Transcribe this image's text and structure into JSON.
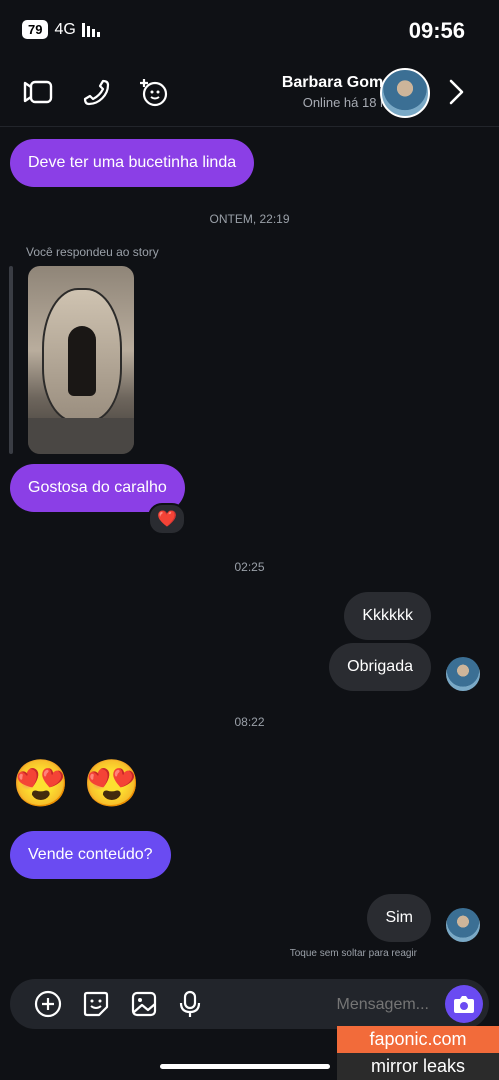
{
  "status_bar": {
    "time": "09:56",
    "network": "4G",
    "battery": "79"
  },
  "header": {
    "name": "Barbara Gomes",
    "status": "Online há 18 min"
  },
  "messages": {
    "m1": "Deve ter uma bucetinha linda",
    "divider1": "ONTEM, 22:19",
    "story_reply_label": "Você respondeu ao story",
    "m2": "Gostosa do caralho",
    "m2_reaction": "❤️",
    "divider2": "02:25",
    "m3": "Kkkkkk",
    "m4": "Obrigada",
    "divider3": "08:22",
    "m5_emoji_1": "😍",
    "m5_emoji_2": "😍",
    "m6": "Vende conteúdo?",
    "m7": "Sim",
    "hint": "Toque sem soltar para reagir"
  },
  "composer": {
    "placeholder": "Mensagem..."
  },
  "watermark": {
    "top": "faponic.com",
    "bottom": "mirror leaks"
  },
  "colors": {
    "purple_bubble": "#8b3fe6",
    "violet_bubble": "#6a4bf2",
    "gray_bubble": "#2a2c31",
    "accent": "#6a4bf2"
  },
  "icons": [
    "back-chevron-icon",
    "video-call-icon",
    "phone-icon",
    "sticker-icon",
    "add-icon",
    "gif-sticker-icon",
    "gallery-icon",
    "mic-icon",
    "camera-icon"
  ]
}
